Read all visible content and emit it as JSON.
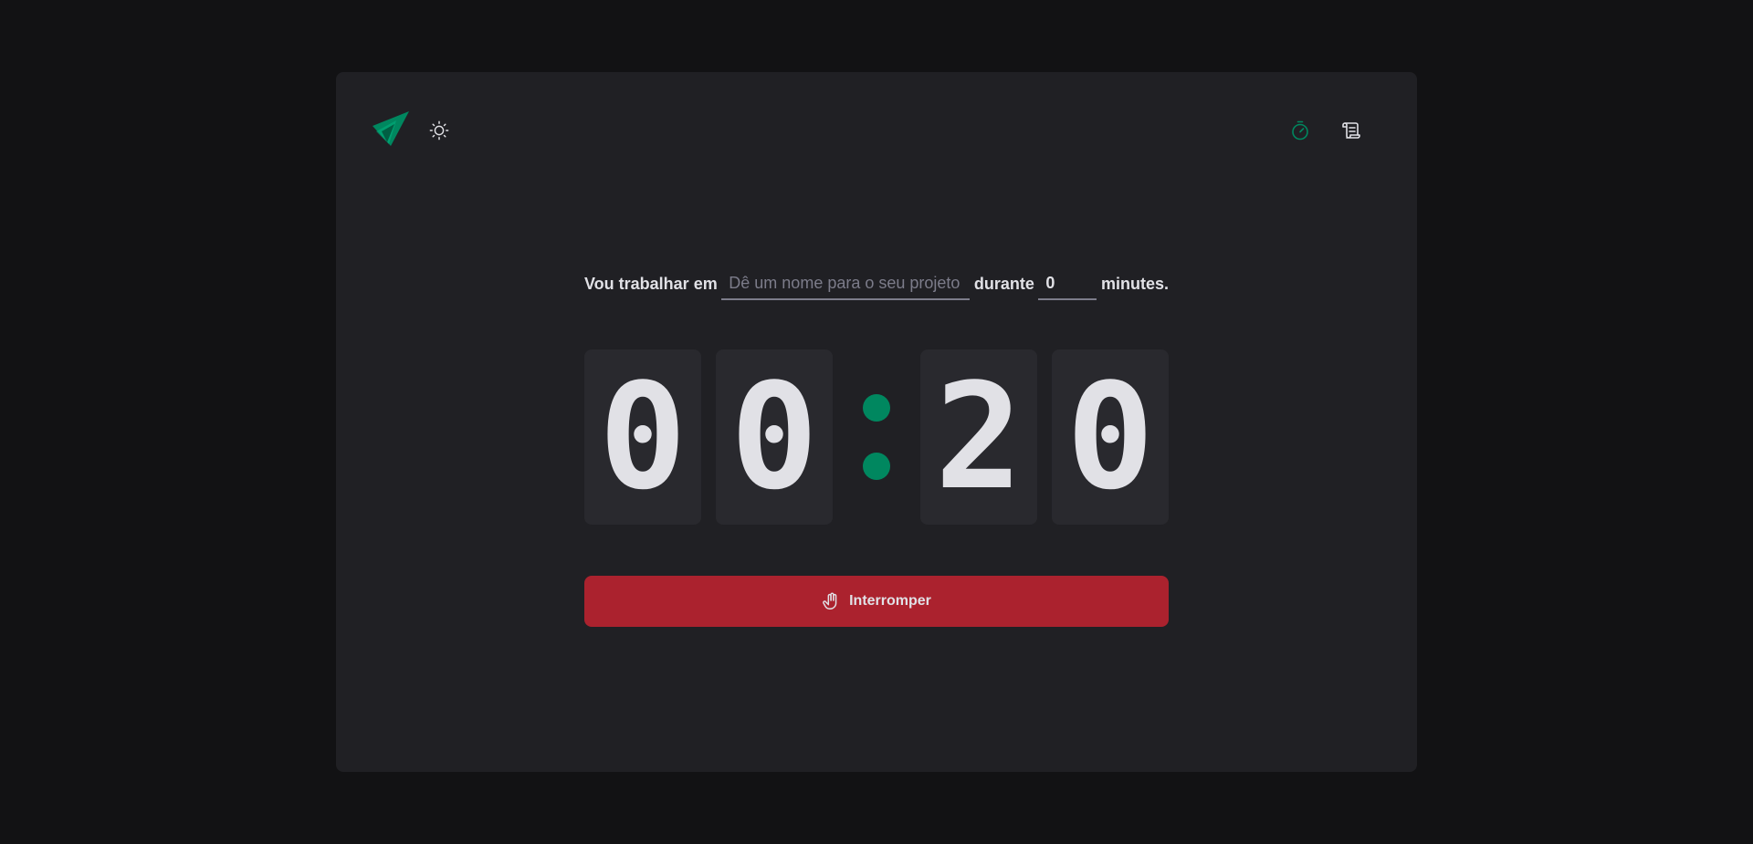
{
  "header": {
    "logo_icon": "ignite-triangles-logo",
    "theme_toggle_icon": "sun-icon",
    "nav": [
      {
        "name": "timer",
        "icon": "timer-icon",
        "active": true
      },
      {
        "name": "history",
        "icon": "scroll-icon",
        "active": false
      }
    ]
  },
  "form": {
    "task_prefix": "Vou trabalhar em",
    "task_value": "",
    "task_placeholder": "Dê um nome para o seu projeto",
    "duration_label": "durante",
    "minutes_value": "0",
    "minutes_suffix": "minutes."
  },
  "countdown": {
    "digits": [
      "0",
      "0",
      "2",
      "0"
    ],
    "separator": ":"
  },
  "stop_button": {
    "label": "Interromper",
    "icon": "hand-palm-icon"
  },
  "colors": {
    "background": "#121214",
    "card": "#202024",
    "digit_box": "#29292e",
    "accent_green": "#00875f",
    "danger_red": "#ab222e",
    "text": "#e1e1e6",
    "placeholder": "#7c7c8a"
  }
}
